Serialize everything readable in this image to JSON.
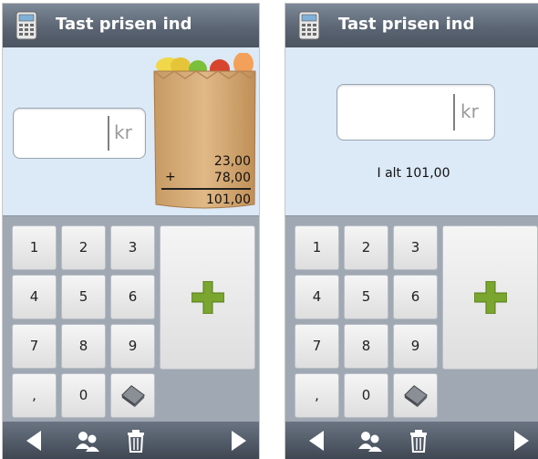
{
  "screens": [
    {
      "title": "Tast prisen ind",
      "price_unit": "kr",
      "receipt": {
        "line1": "23,00",
        "plus_sign": "+",
        "line2": "78,00",
        "total": "101,00"
      },
      "keys": [
        "1",
        "2",
        "3",
        "4",
        "5",
        "6",
        "7",
        "8",
        "9",
        ",",
        "0"
      ]
    },
    {
      "title": "Tast prisen ind",
      "price_unit": "kr",
      "total_label": "I alt 101,00",
      "keys": [
        "1",
        "2",
        "3",
        "4",
        "5",
        "6",
        "7",
        "8",
        "9",
        ",",
        "0"
      ]
    }
  ],
  "icons": {
    "app": "calculator-icon",
    "add": "plus-icon",
    "eraser": "eraser-icon",
    "back": "arrow-left-icon",
    "people": "people-icon",
    "delete": "trash-icon",
    "forward": "arrow-right-icon"
  },
  "colors": {
    "add_button": "#7aa52e",
    "title_bar": "#5b6573",
    "content_bg": "#dce9f6"
  }
}
